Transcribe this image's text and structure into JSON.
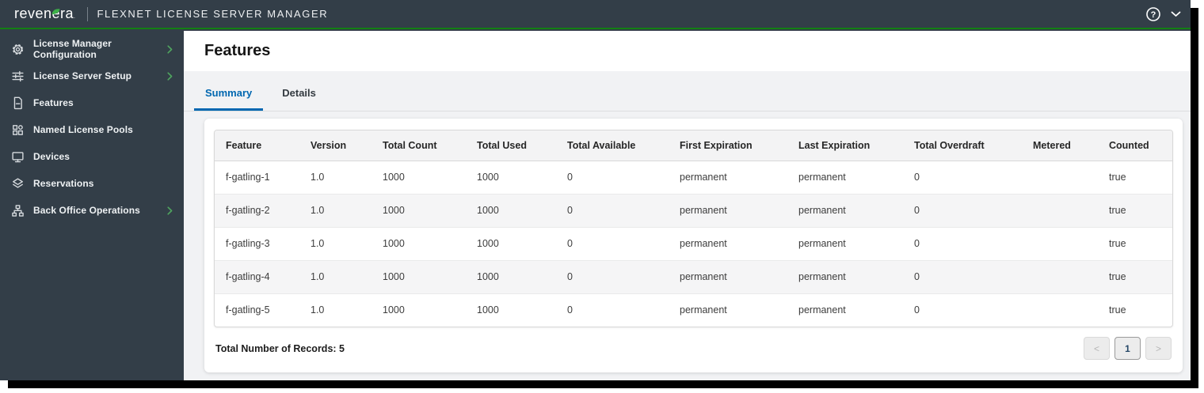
{
  "topbar": {
    "logo_text": "revenera",
    "logo_trademark": ".",
    "product_name": "FLEXNET LICENSE SERVER MANAGER",
    "help_icon": "circled-question-mark",
    "menu_icon": "chevron-down"
  },
  "sidebar": {
    "items": [
      {
        "label": "License Manager Configuration",
        "icon": "gear-icon",
        "expandable": true
      },
      {
        "label": "License Server Setup",
        "icon": "sliders-icon",
        "expandable": true
      },
      {
        "label": "Features",
        "icon": "document-icon",
        "expandable": false
      },
      {
        "label": "Named License Pools",
        "icon": "grid-icon",
        "expandable": false
      },
      {
        "label": "Devices",
        "icon": "monitor-icon",
        "expandable": false
      },
      {
        "label": "Reservations",
        "icon": "layers-icon",
        "expandable": false
      },
      {
        "label": "Back Office Operations",
        "icon": "sitemap-icon",
        "expandable": true
      }
    ]
  },
  "main": {
    "title": "Features",
    "tabs": [
      {
        "label": "Summary",
        "active": true
      },
      {
        "label": "Details",
        "active": false
      }
    ],
    "table": {
      "columns": [
        "Feature",
        "Version",
        "Total Count",
        "Total Used",
        "Total Available",
        "First Expiration",
        "Last Expiration",
        "Total Overdraft",
        "Metered",
        "Counted"
      ],
      "rows": [
        [
          "f-gatling-1",
          "1.0",
          "1000",
          "1000",
          "0",
          "permanent",
          "permanent",
          "0",
          "",
          "true"
        ],
        [
          "f-gatling-2",
          "1.0",
          "1000",
          "1000",
          "0",
          "permanent",
          "permanent",
          "0",
          "",
          "true"
        ],
        [
          "f-gatling-3",
          "1.0",
          "1000",
          "1000",
          "0",
          "permanent",
          "permanent",
          "0",
          "",
          "true"
        ],
        [
          "f-gatling-4",
          "1.0",
          "1000",
          "1000",
          "0",
          "permanent",
          "permanent",
          "0",
          "",
          "true"
        ],
        [
          "f-gatling-5",
          "1.0",
          "1000",
          "1000",
          "0",
          "permanent",
          "permanent",
          "0",
          "",
          "true"
        ]
      ]
    },
    "footer": {
      "total_records_label": "Total Number of Records: 5",
      "pagination": {
        "prev": "<",
        "current_page": "1",
        "next": ">"
      }
    }
  },
  "colors": {
    "topbar_bg": "#333E48",
    "accent_green_line": "#138013",
    "chevron_green": "#4FA55F",
    "leaf_green": "#3DAF49",
    "tab_active_blue": "#0067B0",
    "page_bg": "#f1f2f4",
    "row_alt_bg": "#f5f5f6"
  }
}
